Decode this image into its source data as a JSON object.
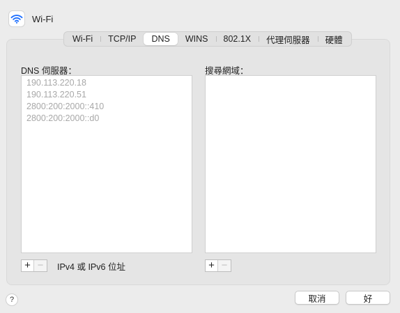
{
  "header": {
    "title": "Wi-Fi",
    "icon": "wifi-icon"
  },
  "tabs": [
    {
      "label": "Wi-Fi",
      "active": false
    },
    {
      "label": "TCP/IP",
      "active": false
    },
    {
      "label": "DNS",
      "active": true
    },
    {
      "label": "WINS",
      "active": false
    },
    {
      "label": "802.1X",
      "active": false
    },
    {
      "label": "代理伺服器",
      "active": false
    },
    {
      "label": "硬體",
      "active": false
    }
  ],
  "dns": {
    "label": "DNS 伺服器：",
    "servers": [
      "190.113.220.18",
      "190.113.220.51",
      "2800:200:2000::410",
      "2800:200:2000::d0"
    ],
    "hint": "IPv4 或 IPv6 位址"
  },
  "search": {
    "label": "搜尋網域：",
    "domains": []
  },
  "controls": {
    "plus": "+",
    "minus": "−"
  },
  "footer": {
    "help": "?",
    "cancel": "取消",
    "ok": "好"
  },
  "colors": {
    "accent": "#1e6fff"
  }
}
